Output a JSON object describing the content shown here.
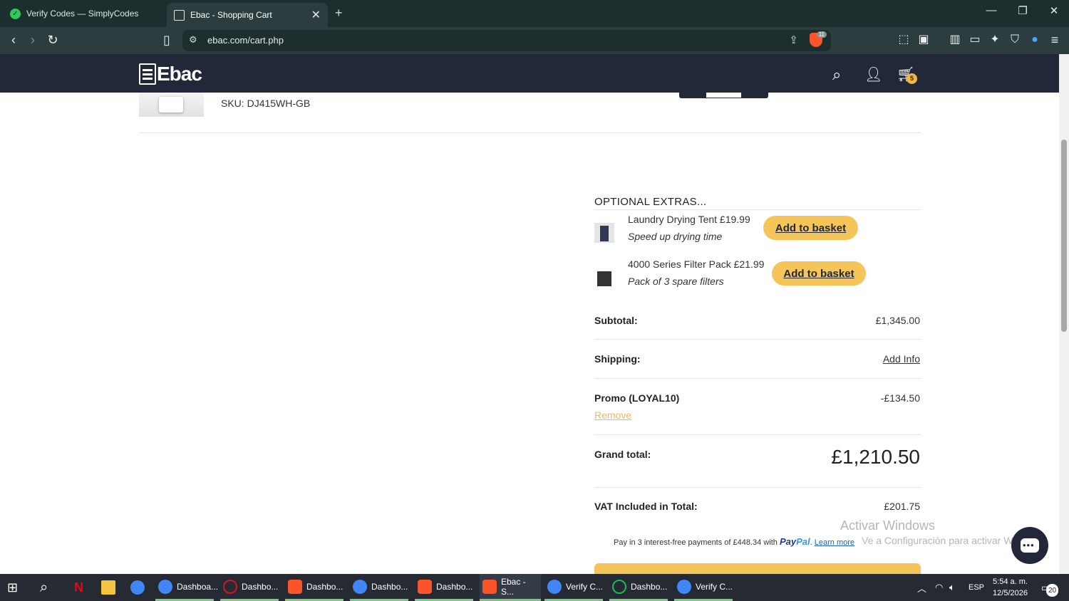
{
  "browser": {
    "tabs": [
      {
        "title": "Verify Codes — SimplyCodes",
        "active": false
      },
      {
        "title": "Ebac - Shopping Cart",
        "active": true
      }
    ],
    "url": "ebac.com/cart.php",
    "brave_badge": "11"
  },
  "site": {
    "logo_text": "Ebac",
    "cart_count": "5"
  },
  "cart_item": {
    "sku_label": "SKU:",
    "sku": "DJ415WH-GB"
  },
  "extras": {
    "title": "OPTIONAL EXTRAS...",
    "items": [
      {
        "name": "Laundry Drying Tent £19.99",
        "desc": "Speed up drying time",
        "button": "Add to basket"
      },
      {
        "name": "4000 Series Filter Pack £21.99",
        "desc": "Pack of 3 spare filters",
        "button": "Add to basket"
      }
    ]
  },
  "totals": {
    "subtotal_label": "Subtotal:",
    "subtotal_value": "£1,345.00",
    "shipping_label": "Shipping:",
    "shipping_value": "Add Info",
    "promo_label": "Promo (LOYAL10)",
    "promo_value": "-£134.50",
    "remove_label": "Remove",
    "grand_label": "Grand total:",
    "grand_value": "£1,210.50",
    "vat_label": "VAT Included in Total:",
    "vat_value": "£201.75"
  },
  "paypal": {
    "text": "Pay in 3 interest-free payments of £448.34 with",
    "logo_a": "Pay",
    "logo_b": "Pal",
    "dot": ".",
    "learn": "Learn more"
  },
  "watermark": {
    "line1": "Activar Windows",
    "line2": "Ve a Configuración para activar Windows."
  },
  "taskbar": {
    "items": [
      {
        "label": "Dashboa...",
        "color": "#4285f4"
      },
      {
        "label": "Dashbo...",
        "color": "#d3162a"
      },
      {
        "label": "Dashbo...",
        "color": "#fb542b"
      },
      {
        "label": "Dashbo...",
        "color": "#4285f4"
      },
      {
        "label": "Dashbo...",
        "color": "#fb542b"
      },
      {
        "label": "Ebac - S...",
        "color": "#fb542b"
      },
      {
        "label": "Verify C...",
        "color": "#4285f4"
      },
      {
        "label": "Dashbo...",
        "color": "#1db954"
      },
      {
        "label": "Verify C...",
        "color": "#4285f4"
      }
    ],
    "lang": "ESP",
    "time": "5:54 a. m.",
    "date": "12/5/2026",
    "notifications": "20"
  }
}
